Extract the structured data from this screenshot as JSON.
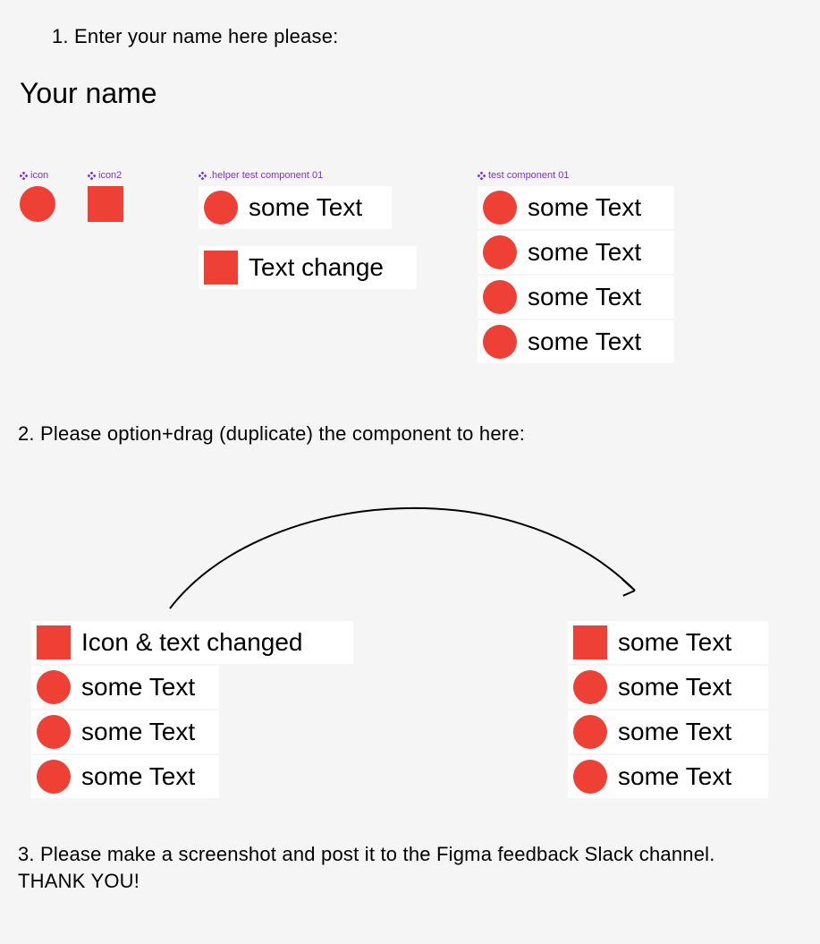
{
  "instructions": {
    "step1": "1. Enter your name here please:",
    "step2": "2. Please option+drag (duplicate) the component to here:",
    "step3": "3. Please make a screenshot and post it to the Figma feedback Slack channel. THANK YOU!"
  },
  "name_heading": "Your name",
  "labels": {
    "icon": "icon",
    "icon2": "icon2",
    "helper": ".helper test component 01",
    "comp01": "test component 01"
  },
  "helper_row1_text": "some Text",
  "helper_row2_text": "Text change",
  "comp01_items": {
    "0": "some Text",
    "1": "some Text",
    "2": "some Text",
    "3": "some Text"
  },
  "compA_items": {
    "0": "Icon & text changed",
    "1": "some Text",
    "2": "some Text",
    "3": "some Text"
  },
  "compB_items": {
    "0": "some Text",
    "1": "some Text",
    "2": "some Text",
    "3": "some Text"
  },
  "colors": {
    "red": "#ee4035",
    "purple": "#7b2ff2"
  }
}
